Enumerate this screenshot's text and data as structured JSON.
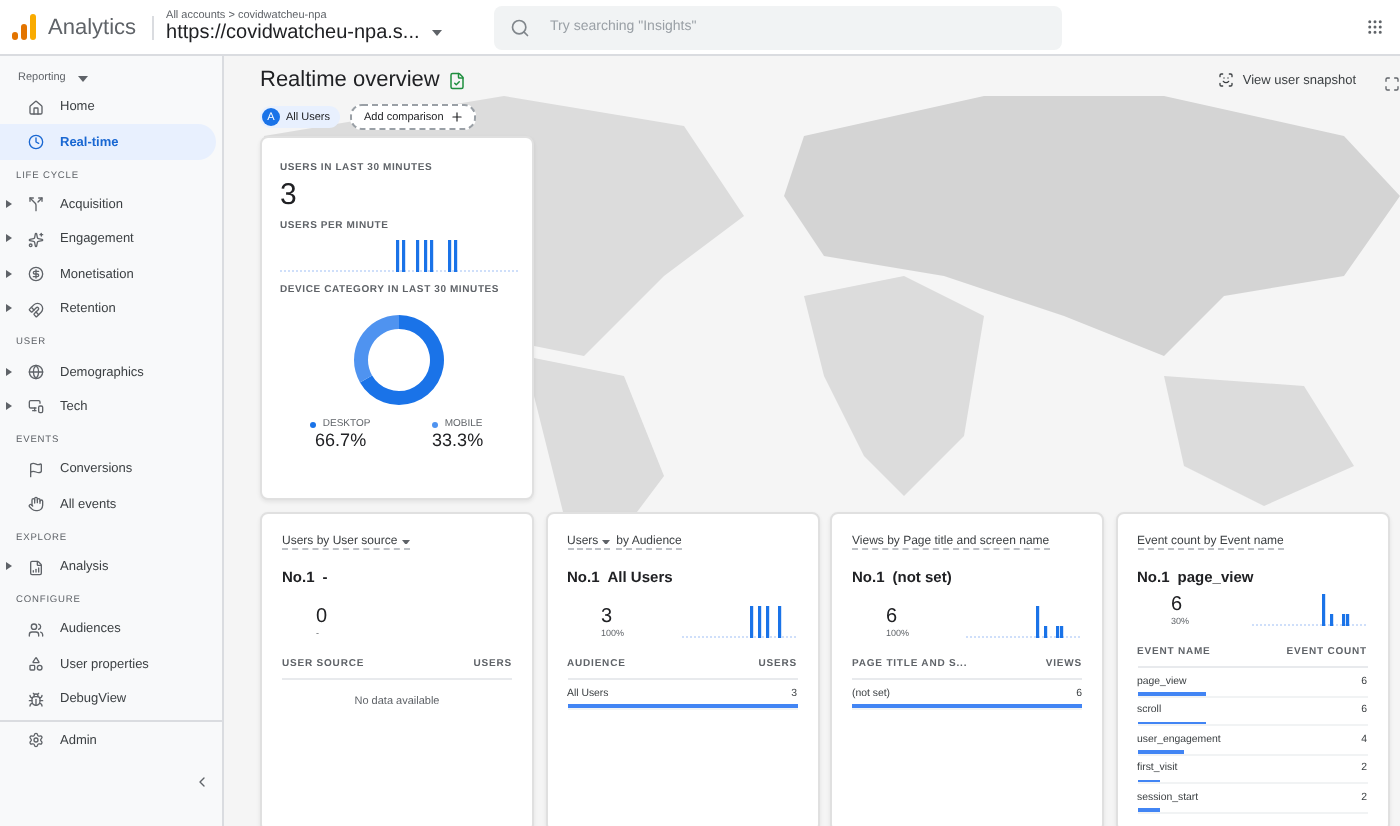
{
  "header": {
    "product": "Analytics",
    "breadcrumb": "All accounts > covidwatcheu-npa",
    "property": "https://covidwatcheu-npa.s...",
    "search": {
      "placeholder": "Try searching \"Insights\""
    }
  },
  "sidebar": {
    "reporting": "Reporting",
    "top_items": [
      {
        "label": "Home",
        "selected": false,
        "expandable": false
      },
      {
        "label": "Real-time",
        "selected": true,
        "expandable": false
      }
    ],
    "sections": [
      {
        "heading": "LIFE CYCLE",
        "items": [
          {
            "label": "Acquisition",
            "selected": false,
            "expandable": true
          },
          {
            "label": "Engagement",
            "selected": false,
            "expandable": true
          },
          {
            "label": "Monetisation",
            "selected": false,
            "expandable": true
          },
          {
            "label": "Retention",
            "selected": false,
            "expandable": true
          }
        ]
      },
      {
        "heading": "USER",
        "items": [
          {
            "label": "Demographics",
            "selected": false,
            "expandable": true
          },
          {
            "label": "Tech",
            "selected": false,
            "expandable": true
          }
        ]
      },
      {
        "heading": "EVENTS",
        "items": [
          {
            "label": "Conversions",
            "selected": false,
            "expandable": false
          },
          {
            "label": "All events",
            "selected": false,
            "expandable": false
          }
        ]
      },
      {
        "heading": "EXPLORE",
        "items": [
          {
            "label": "Analysis",
            "selected": false,
            "expandable": true
          }
        ]
      },
      {
        "heading": "CONFIGURE",
        "items": [
          {
            "label": "Audiences",
            "selected": false,
            "expandable": false
          },
          {
            "label": "User properties",
            "selected": false,
            "expandable": false
          },
          {
            "label": "DebugView",
            "selected": false,
            "expandable": false
          }
        ]
      }
    ],
    "admin": "Admin"
  },
  "page": {
    "title": "Realtime overview",
    "chips": [
      {
        "kind": "segment",
        "badge": "A",
        "label": "All Users"
      },
      {
        "kind": "add",
        "label": "Add comparison"
      }
    ],
    "snapshot_button": "View user snapshot"
  },
  "summary_card": {
    "users_label": "USERS IN LAST 30 MINUTES",
    "users_value": "3",
    "per_minute_label": "USERS PER MINUTE",
    "device_label": "DEVICE CATEGORY IN LAST 30 MINUTES",
    "chart_data": {
      "type": "donut",
      "categories": [
        "DESKTOP",
        "MOBILE"
      ],
      "values": [
        66.7,
        33.3
      ],
      "value_labels": [
        "66.7%",
        "33.3%"
      ],
      "data_labels": true,
      "legend": "bottom"
    }
  },
  "cards": [
    {
      "title": [
        {
          "text": "Users by User source",
          "dropdown": true
        }
      ],
      "rank": "No.1",
      "top_name": "-",
      "value": "0",
      "sub": "-",
      "sparkline": false,
      "columns": [
        "USER SOURCE",
        "USERS"
      ],
      "empty_text": "No data available"
    },
    {
      "title": [
        {
          "text": "Users",
          "dropdown": true
        },
        {
          "text": "by Audience",
          "dropdown": false
        }
      ],
      "rank": "No.1",
      "top_name": "All Users",
      "value": "3",
      "sub": "100%",
      "sparkline": true,
      "columns": [
        "AUDIENCE",
        "USERS"
      ],
      "rows": [
        {
          "label": "All Users",
          "value": "3",
          "level": 1
        }
      ]
    },
    {
      "title": [
        {
          "text": "Views by Page title and screen name",
          "dropdown": false
        }
      ],
      "rank": "No.1",
      "top_name": "(not set)",
      "value": "6",
      "sub": "100%",
      "sparkline": true,
      "columns": [
        "PAGE TITLE AND S...",
        "VIEWS"
      ],
      "rows": [
        {
          "label": "(not set)",
          "value": "6",
          "level": 1
        }
      ]
    },
    {
      "title": [
        {
          "text": "Event count by Event name",
          "dropdown": false
        }
      ],
      "rank": "No.1",
      "top_name": "page_view",
      "value": "6",
      "sub": "30%",
      "sparkline": true,
      "columns": [
        "EVENT NAME",
        "EVENT COUNT"
      ],
      "rows": [
        {
          "label": "page_view",
          "value": "6",
          "level": 0.3
        },
        {
          "label": "scroll",
          "value": "6",
          "level": 0.3
        },
        {
          "label": "user_engagement",
          "value": "4",
          "level": 0.2
        },
        {
          "label": "first_visit",
          "value": "2",
          "level": 0.1
        },
        {
          "label": "session_start",
          "value": "2",
          "level": 0.1
        }
      ]
    }
  ]
}
